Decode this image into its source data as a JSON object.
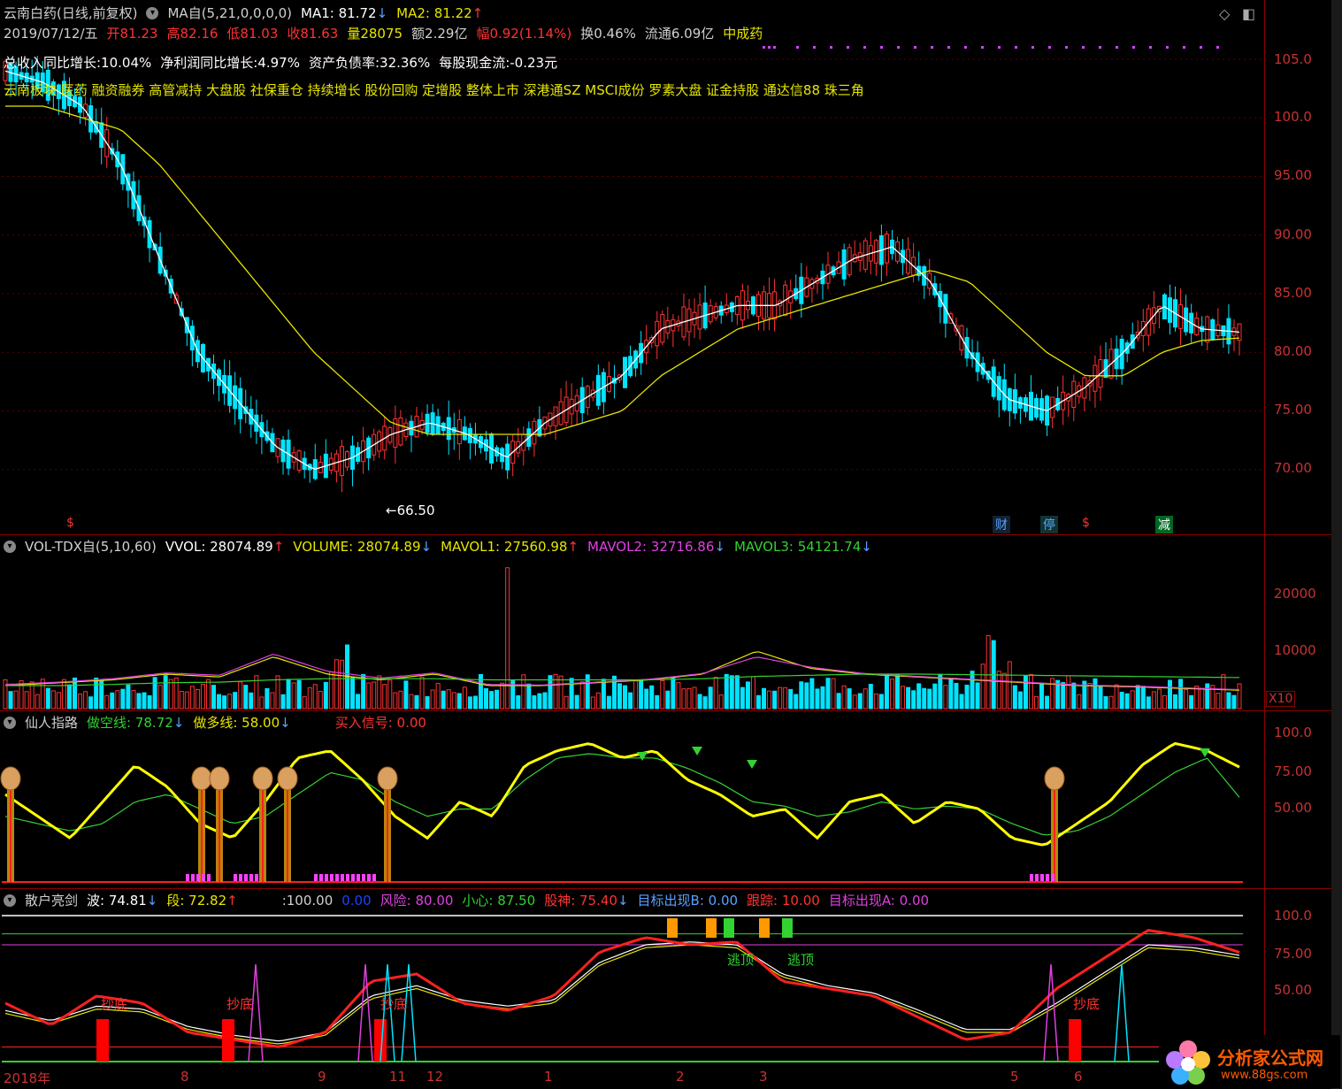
{
  "header": {
    "stock_name": "云南白药(日线,前复权)",
    "ma_title": "MA自(5,21,0,0,0,0)",
    "ma1": "MA1: 81.72",
    "ma2": "MA2: 81.22",
    "date": "2019/07/12/五",
    "open": "开81.23",
    "high": "高82.16",
    "low": "低81.03",
    "close": "收81.63",
    "volume": "量28075",
    "amount": "额2.29亿",
    "change": "幅0.92(1.14%)",
    "turnover": "换0.46%",
    "float": "流通6.09亿",
    "sector": "中成药",
    "fundamentals": [
      "总收入同比增长:10.04%",
      "净利润同比增长:4.97%",
      "资产负债率:32.36%",
      "每股现金流:-0.23元"
    ],
    "concepts": "云南板块 医药 融资融券 高管减持 大盘股 社保重仓 持续增长 股份回购 定增股 整体上市 深港通SZ MSCI成份 罗素大盘 证金持股 通达信88 珠三角",
    "low_marker": "66.50",
    "event_labels": [
      "财",
      "停",
      "$",
      "减",
      "$"
    ]
  },
  "volume_panel": {
    "title": "VOL-TDX自(5,10,60)",
    "vvol": "VVOL: 28074.89",
    "volume": "VOLUME: 28074.89",
    "mavol1": "MAVOL1: 27560.98",
    "mavol2": "MAVOL2: 32716.86",
    "mavol3": "MAVOL3: 54121.74",
    "unit": "X10"
  },
  "xianren_panel": {
    "title": "仙人指路",
    "short_line": "做空线: 78.72",
    "long_line": "做多线: 58.00",
    "buy_signal": "买入信号: 0.00"
  },
  "sanhu_panel": {
    "title": "散户亮剑",
    "wave": "波: 74.81",
    "segment": "段: 72.82",
    "const": ":100.00",
    "zero": "0.00",
    "risk": "风险: 80.00",
    "careful": "小心: 87.50",
    "stock_god": "股神: 75.40",
    "target_b": "目标出现B: 0.00",
    "track": "跟踪: 10.00",
    "target_a": "目标出现A: 0.00",
    "bottom_labels": [
      "抄底",
      "抄底",
      "抄底",
      "抄底"
    ],
    "escape_labels": [
      "逃顶",
      "逃顶"
    ]
  },
  "axes": {
    "price_ticks": [
      "105.0",
      "100.0",
      "95.00",
      "90.00",
      "85.00",
      "80.00",
      "75.00",
      "70.00"
    ],
    "volume_ticks": [
      "20000",
      "10000"
    ],
    "osc_ticks": [
      "100.0",
      "75.00",
      "50.00"
    ],
    "osc2_ticks": [
      "100.0",
      "75.00",
      "50.00"
    ],
    "x_ticks": [
      "2018年",
      "8",
      "9",
      "11",
      "12",
      "1",
      "2",
      "3",
      "5",
      "6"
    ]
  },
  "watermark": {
    "name": "分析家公式网",
    "url": "www.88gs.com"
  },
  "colors": {
    "up": "#ff3232",
    "down": "#00e4ff",
    "ma1": "#ffffff",
    "ma2": "#e6e600",
    "axis": "#8b0000"
  },
  "chart_data": [
    {
      "type": "candlestick",
      "title": "云南白药(日线,前复权)",
      "x": [
        "2018年",
        "8",
        "9",
        "11",
        "12",
        "1",
        "2",
        "3",
        "5",
        "6"
      ],
      "ylim": [
        67,
        107
      ],
      "series": [
        {
          "name": "MA1",
          "values": [
            104,
            103,
            101,
            96,
            88,
            80,
            76,
            72,
            70,
            71,
            73,
            74,
            73,
            71,
            74,
            76,
            78,
            82,
            83,
            84,
            84,
            86,
            88,
            89,
            86,
            80,
            76,
            75,
            77,
            80,
            84,
            82,
            81.72
          ]
        },
        {
          "name": "MA2",
          "values": [
            101,
            101,
            100,
            99,
            96,
            92,
            88,
            84,
            80,
            77,
            74,
            73,
            73,
            73,
            73,
            74,
            75,
            78,
            80,
            82,
            83,
            84,
            85,
            86,
            87,
            86,
            83,
            80,
            78,
            78,
            80,
            81,
            81.22
          ]
        }
      ]
    },
    {
      "type": "bar",
      "title": "VOL-TDX自(5,10,60)",
      "ylim": [
        0,
        26000
      ],
      "series": [
        {
          "name": "MAVOL1",
          "values": [
            4000,
            4500,
            5000,
            6000,
            5500,
            9000,
            6000,
            5000,
            6000,
            4000,
            4000,
            4500,
            5000,
            6000,
            10000,
            7000,
            6000,
            5500,
            5000,
            4500,
            4000,
            3800,
            3500,
            3200
          ]
        },
        {
          "name": "MAVOL2",
          "values": [
            4200,
            4600,
            5200,
            6200,
            5800,
            9500,
            6500,
            5300,
            6200,
            4200,
            4100,
            4600,
            5100,
            6100,
            9000,
            7200,
            6100,
            5600,
            5100,
            4600,
            4100,
            3900,
            3600,
            3300
          ]
        },
        {
          "name": "MAVOL3",
          "values": [
            4000,
            4000,
            4200,
            4500,
            4600,
            5000,
            5200,
            5200,
            5200,
            5000,
            5000,
            5000,
            5000,
            5200,
            5600,
            5800,
            6000,
            6000,
            5900,
            5800,
            5700,
            5600,
            5500,
            5400
          ]
        }
      ]
    },
    {
      "type": "line",
      "title": "仙人指路",
      "ylim": [
        0,
        105
      ],
      "series": [
        {
          "name": "做空线",
          "values": [
            60,
            45,
            30,
            55,
            80,
            65,
            40,
            30,
            55,
            85,
            90,
            70,
            45,
            30,
            55,
            45,
            80,
            90,
            95,
            85,
            90,
            70,
            60,
            45,
            50,
            30,
            55,
            60,
            40,
            55,
            50,
            30,
            25,
            40,
            55,
            80,
            95,
            90,
            78.72
          ]
        },
        {
          "name": "做多线",
          "values": [
            45,
            40,
            35,
            40,
            55,
            60,
            50,
            40,
            45,
            60,
            75,
            70,
            55,
            45,
            50,
            50,
            70,
            85,
            88,
            85,
            85,
            78,
            68,
            55,
            52,
            45,
            48,
            55,
            50,
            52,
            50,
            40,
            32,
            35,
            45,
            60,
            75,
            85,
            58.0
          ]
        }
      ]
    },
    {
      "type": "line",
      "title": "散户亮剑",
      "ylim": [
        0,
        110
      ],
      "series": [
        {
          "name": "波",
          "values": [
            40,
            25,
            45,
            40,
            20,
            15,
            10,
            20,
            55,
            60,
            40,
            35,
            45,
            75,
            85,
            80,
            82,
            55,
            50,
            45,
            30,
            15,
            20,
            50,
            70,
            90,
            85,
            74.81
          ]
        },
        {
          "name": "段",
          "values": [
            35,
            28,
            38,
            36,
            24,
            18,
            14,
            20,
            45,
            52,
            42,
            38,
            42,
            68,
            80,
            82,
            80,
            60,
            52,
            47,
            35,
            22,
            22,
            40,
            60,
            80,
            78,
            72.82
          ]
        }
      ]
    }
  ]
}
